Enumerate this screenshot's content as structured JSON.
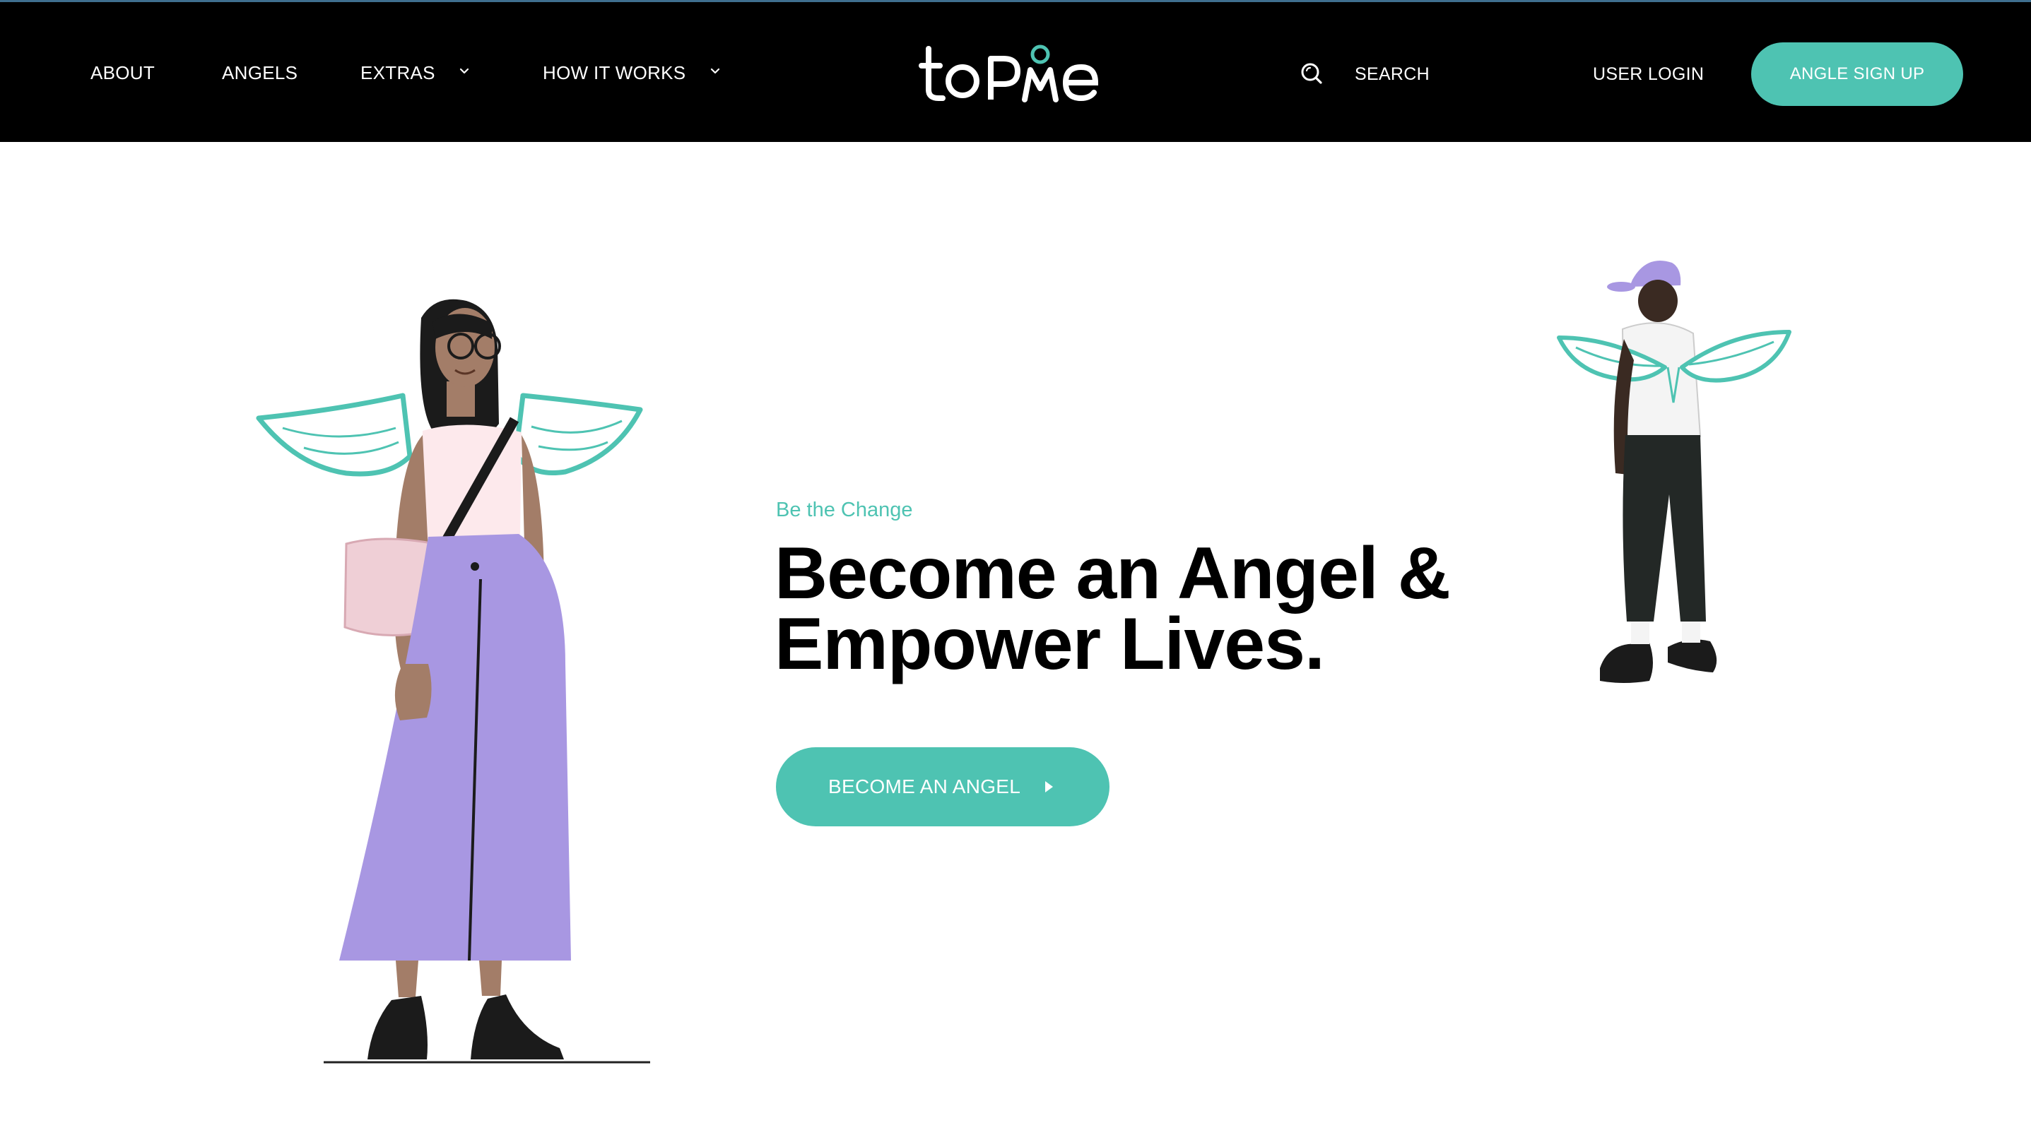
{
  "header": {
    "nav": [
      {
        "label": "ABOUT"
      },
      {
        "label": "ANGELS"
      },
      {
        "label": "EXTRAS",
        "has_dropdown": true
      },
      {
        "label": "HOW IT WORKS",
        "has_dropdown": true
      }
    ],
    "logo_text": "toPMe",
    "search_label": "SEARCH",
    "login_label": "USER LOGIN",
    "signup_label": "ANGLE SIGN UP"
  },
  "hero": {
    "eyebrow": "Be the Change",
    "headline_line1": "Become an Angel &",
    "headline_line2": "Empower Lives.",
    "cta_label": "BECOME AN ANGEL"
  },
  "icons": {
    "search": "search-icon",
    "dropdown": "chevron-down-icon",
    "cta_arrow": "play-arrow-icon"
  },
  "colors": {
    "header_bg": "#000000",
    "accent": "#4ec3b2",
    "skirt": "#a897e2",
    "text_dark": "#000000"
  }
}
